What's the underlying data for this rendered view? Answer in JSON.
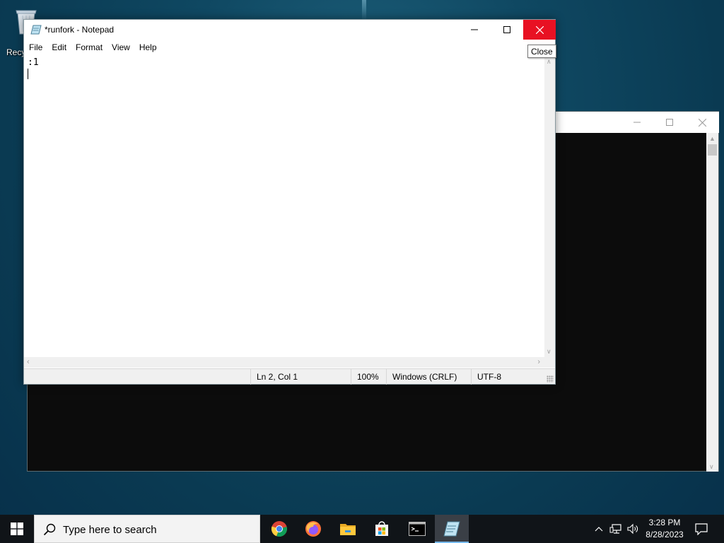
{
  "desktop": {
    "recycle_bin_label": "Recycle Bin"
  },
  "notepad": {
    "title": "*runfork - Notepad",
    "menu": [
      "File",
      "Edit",
      "Format",
      "View",
      "Help"
    ],
    "content_line1": ":1",
    "status": {
      "position": "Ln 2, Col 1",
      "zoom": "100%",
      "line_endings": "Windows (CRLF)",
      "encoding": "UTF-8"
    },
    "close_tooltip": "Close"
  },
  "taskbar": {
    "search_placeholder": "Type here to search",
    "apps": [
      "chrome-icon",
      "firefox-icon",
      "file-explorer-icon",
      "store-icon",
      "terminal-icon",
      "notepad-icon"
    ],
    "active_app": "notepad-icon",
    "time": "3:28 PM",
    "date": "8/28/2023"
  },
  "colors": {
    "close_red": "#e81123",
    "taskbar": "#101418",
    "accent": "#76b9ed"
  }
}
